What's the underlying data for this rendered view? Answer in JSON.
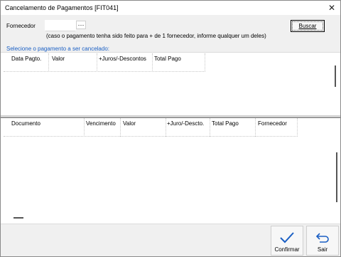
{
  "window": {
    "title": "Cancelamento de Pagamentos [FIT041]",
    "close_symbol": "✕"
  },
  "filter": {
    "label": "Fornecedor",
    "value": "",
    "lookup_symbol": "···",
    "hint": "(caso o pagamento tenha sido feito para + de 1 fornecedor, informe qualquer um deles)",
    "search_label": "Buscar"
  },
  "payments": {
    "instruction": "Selecione o pagamento a ser cancelado:",
    "columns": [
      "Data Pagto.",
      "Valor",
      "+Juros/-Descontos",
      "Total Pago"
    ],
    "rows": []
  },
  "documents": {
    "columns": [
      "Documento",
      "Vencimento",
      "Valor",
      "+Juro/-Descto.",
      "Total Pago",
      "Fornecedor"
    ],
    "rows": []
  },
  "footer": {
    "confirm_label": "Confirmar",
    "exit_label": "Sair"
  },
  "icons": {
    "confirm": "check-icon",
    "exit": "return-arrow-icon"
  },
  "colors": {
    "accent": "#1a5fc4",
    "window_bg": "#f0f0f0",
    "panel_bg": "#ffffff"
  }
}
